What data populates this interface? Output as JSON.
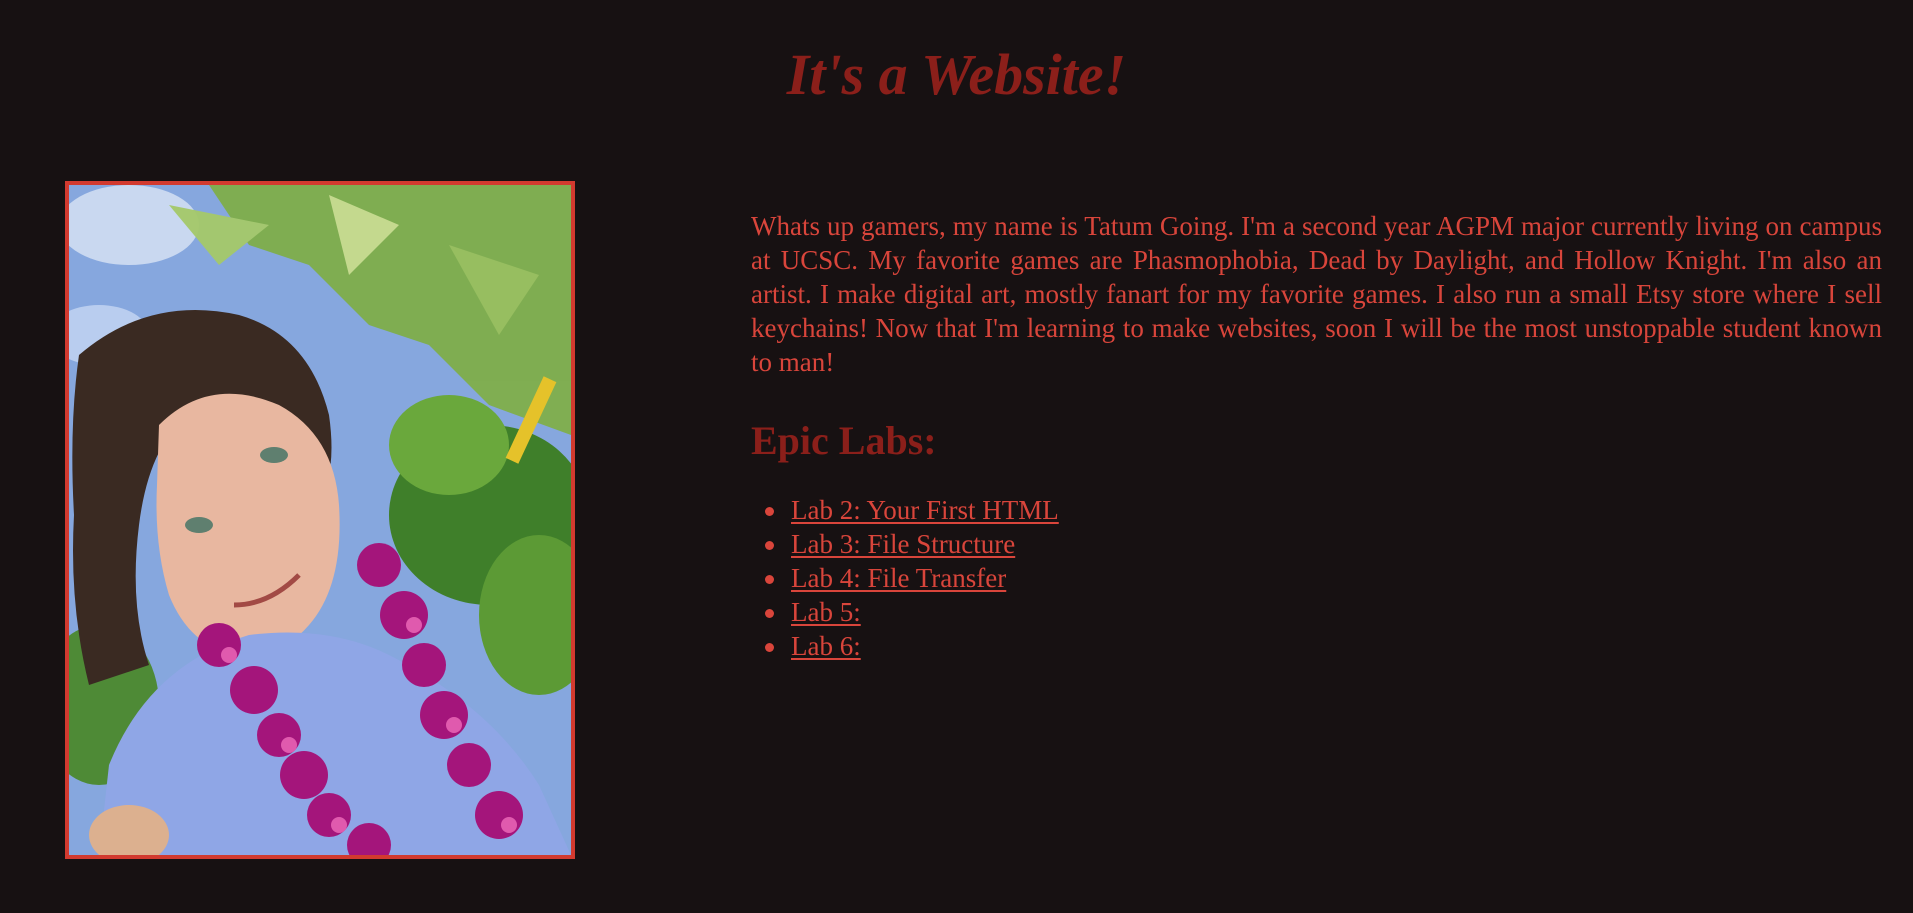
{
  "header": {
    "title": "It's a Website!"
  },
  "profile": {
    "photo_icon": "portrait-photo",
    "bio": "Whats up gamers, my name is Tatum Going. I'm a second year AGPM major currently living on campus at UCSC. My favorite games are Phasmophobia, Dead by Daylight, and Hollow Knight. I'm also an artist. I make digital art, mostly fanart for my favorite games. I also run a small Etsy store where I sell keychains! Now that I'm learning to make websites, soon I will be the most unstoppable student known to man!"
  },
  "labs": {
    "heading": "Epic Labs:",
    "items": [
      {
        "label": "Lab 2: Your First HTML"
      },
      {
        "label": "Lab 3: File Structure"
      },
      {
        "label": "Lab 4: File Transfer"
      },
      {
        "label": "Lab 5:"
      },
      {
        "label": "Lab 6:"
      }
    ]
  },
  "colors": {
    "background": "#171112",
    "title": "#8b1f1a",
    "text": "#d9453b",
    "frame": "#d23a2f"
  }
}
